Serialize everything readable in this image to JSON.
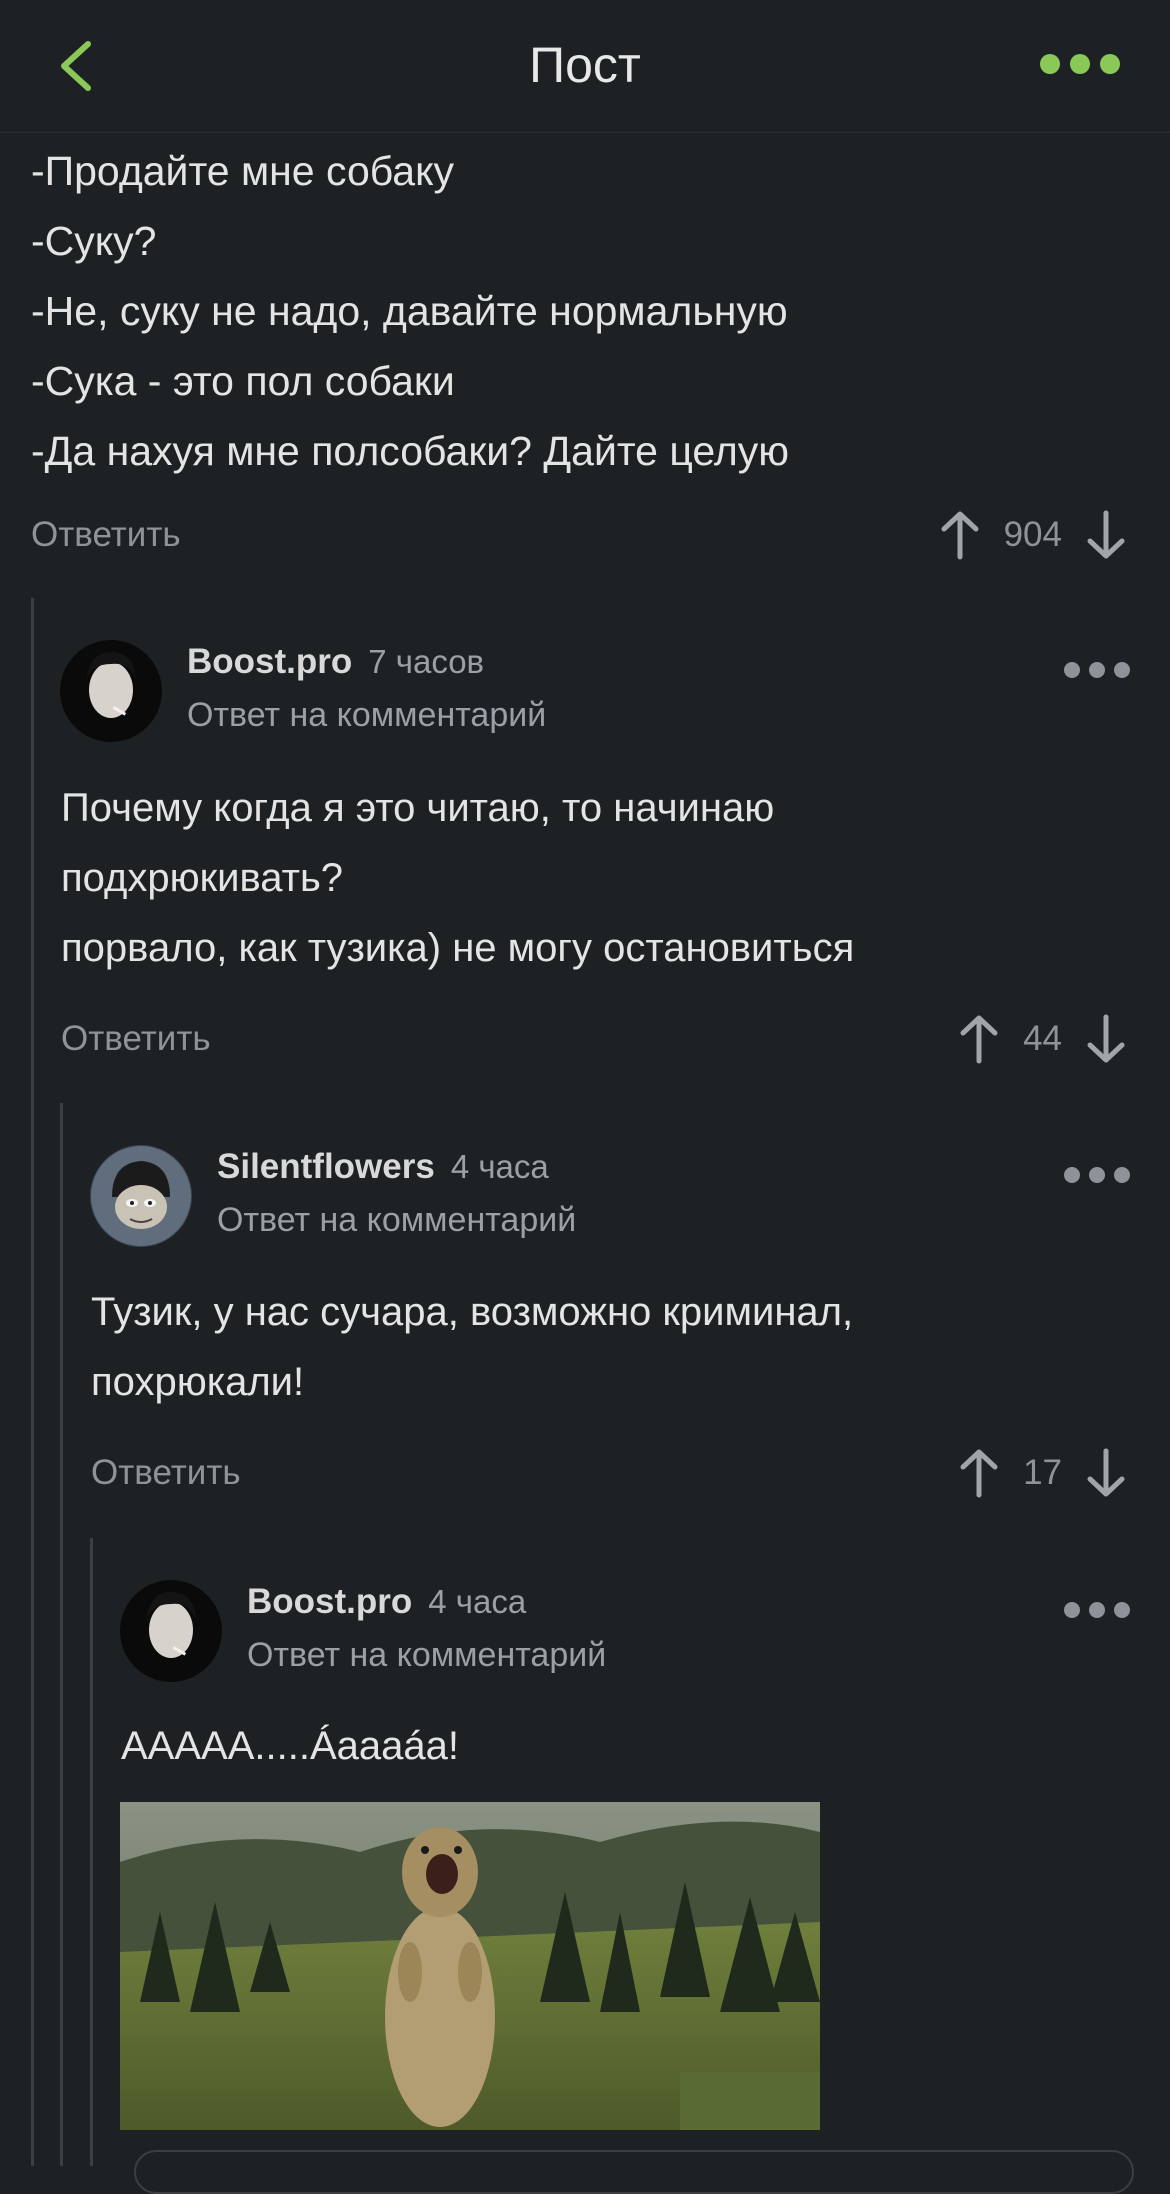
{
  "header": {
    "title": "Пост",
    "back_icon": "chevron-left-icon",
    "more_icon": "more-dots-icon",
    "accent": "#8ac858"
  },
  "post": {
    "lines": [
      "-Продайте мне собаку",
      "-Суку?",
      "-Не, суку не надо, давайте нормальную",
      "-Сука - это пол собаки",
      "-Да нахуя мне полсобаки? Дайте целую"
    ],
    "reply_label": "Ответить",
    "votes": "904"
  },
  "comments": [
    {
      "author": "Boost.pro",
      "time": "7 часов",
      "reply_to": "Ответ на комментарий",
      "lines": [
        "Почему когда я это читаю, то начинаю",
        "подхрюкивать?",
        "порвало, как тузика) не могу остановиться"
      ],
      "reply_label": "Ответить",
      "votes": "44"
    },
    {
      "author": "Silentflowers",
      "time": "4 часа",
      "reply_to": "Ответ на комментарий",
      "lines": [
        "Тузик, у нас сучара, возможно криминал,",
        "похрюкали!"
      ],
      "reply_label": "Ответить",
      "votes": "17"
    },
    {
      "author": "Boost.pro",
      "time": "4 часа",
      "reply_to": "Ответ на комментарий",
      "lines": [
        "ААААА.....Áаааáа!"
      ]
    }
  ]
}
